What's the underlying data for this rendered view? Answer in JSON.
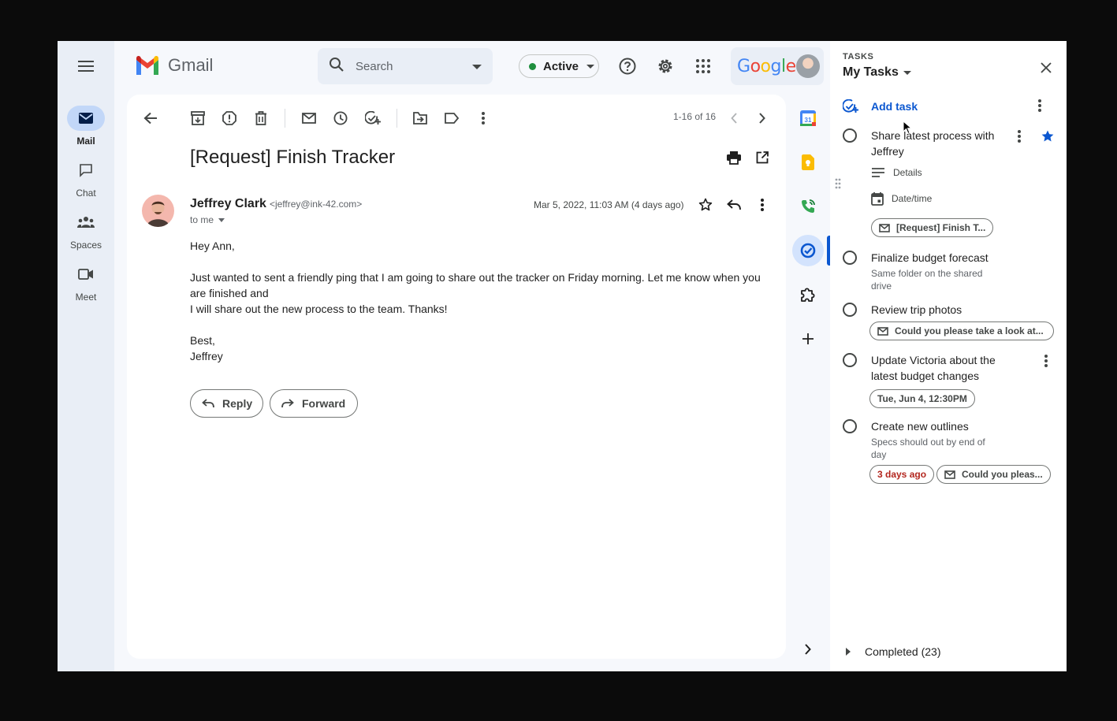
{
  "nav": {
    "items": [
      {
        "label": "Mail",
        "icon": "mail-icon"
      },
      {
        "label": "Chat",
        "icon": "chat-icon"
      },
      {
        "label": "Spaces",
        "icon": "spaces-icon"
      },
      {
        "label": "Meet",
        "icon": "meet-icon"
      }
    ]
  },
  "header": {
    "app_name": "Gmail",
    "search_placeholder": "Search",
    "status_label": "Active",
    "status_color": "#1e8e3e",
    "google_label": "Google"
  },
  "toolbar": {
    "pager": "1-16 of 16"
  },
  "email": {
    "subject": "[Request] Finish Tracker",
    "sender_name": "Jeffrey Clark",
    "sender_email": "<jeffrey@ink-42.com>",
    "to": "to me",
    "date": "Mar 5, 2022, 11:03 AM (4 days ago)",
    "greeting": "Hey Ann,",
    "body_line1": "Just wanted to sent a friendly ping that I am going to share out the tracker on Friday morning. Let me know when you are finished and",
    "body_line2": "I will share out the new process to the team. Thanks!",
    "signoff": "Best,",
    "signature": "Jeffrey",
    "reply_label": "Reply",
    "forward_label": "Forward"
  },
  "tasks": {
    "kicker": "TASKS",
    "list_name": "My Tasks",
    "add_label": "Add task",
    "items": [
      {
        "title": "Share latest process with Jeffrey",
        "details_label": "Details",
        "datetime_label": "Date/time",
        "chip": "[Request] Finish T...",
        "starred": true
      },
      {
        "title": "Finalize budget forecast",
        "note": "Same folder on the shared drive"
      },
      {
        "title": "Review trip photos",
        "chip": "Could you please take a look at..."
      },
      {
        "title": "Update Victoria about the latest budget changes",
        "chip": "Tue, Jun 4, 12:30PM"
      },
      {
        "title": "Create new outlines",
        "note": "Specs should out by end of day",
        "chip_due": "3 days ago",
        "chip": "Could you pleas..."
      }
    ],
    "completed_label": "Completed (23)"
  },
  "colors": {
    "accent": "#0b57d0",
    "overdue": "#b3261e",
    "rail_bg": "#e9eef6"
  }
}
